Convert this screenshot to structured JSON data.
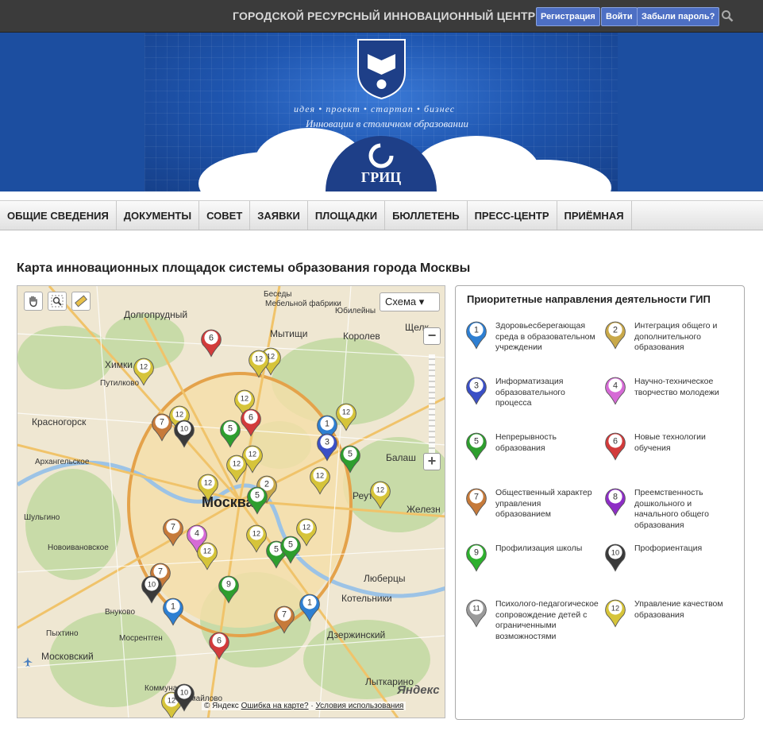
{
  "header": {
    "site_name": "ГОРОДСКОЙ РЕСУРСНЫЙ ИННОВАЦИОННЫЙ ЦЕНТР",
    "register_label": "Регистрация",
    "login_label": "Войти",
    "forgot_label": "Забыли пароль?"
  },
  "banner": {
    "slogan": "идея • проект • стартап • бизнес",
    "subslogan": "Инновации в столичном образовании",
    "logo_text": "ГРИЦ"
  },
  "nav": {
    "items": [
      "ОБЩИЕ СВЕДЕНИЯ",
      "ДОКУМЕНТЫ",
      "СОВЕТ",
      "ЗАЯВКИ",
      "ПЛОЩАДКИ",
      "БЮЛЛЕТЕНЬ",
      "ПРЕСС-ЦЕНТР",
      "ПРИЁМНАЯ"
    ]
  },
  "page_title": "Карта инновационных площадок системы образования города Москвы",
  "map": {
    "type_label": "Схема ▾",
    "zoom_in": "+",
    "zoom_out": "−",
    "copyright": "© Яндекс",
    "report_error": "Ошибка на карте?",
    "terms": "Условия использования",
    "brand": "Яндекс",
    "labels": {
      "dolgoprudny": "Долгопрудный",
      "mytishchi": "Мытищи",
      "korolev": "Королев",
      "khimki": "Химки",
      "putilkovo": "Путилково",
      "krasnogorsk": "Красногорск",
      "arkhangelskoe": "Архангельское",
      "shulgino": "Шульгино",
      "novoivanovskoe": "Новоивановское",
      "vnukovo": "Внуково",
      "moscow": "Москва",
      "balashikha": "Балаш",
      "reutov": "Реут",
      "zheleznodorozhny": "Железн",
      "lyubertsy": "Люберцы",
      "kotelniki": "Котельники",
      "dzerzhinsky": "Дзержинский",
      "lytkarino": "Лыткарино",
      "moskovsky": "Московский",
      "mosrentgen": "Мосрентген",
      "pyktusi": "Пыхтино",
      "shchelkovo": "Щелк",
      "beskudnikovo": "Беседы",
      "mebel": "Мебельной фабрики",
      "yubileyny": "Юбилейны",
      "kommunarka": "Коммунарка",
      "izmaylovo": "Измайлово"
    },
    "pins": [
      {
        "n": "6",
        "color": "#d23b3b"
      },
      {
        "n": "12",
        "color": "#d6c43a"
      },
      {
        "n": "12",
        "color": "#d6c43a"
      },
      {
        "n": "12",
        "color": "#d6c43a"
      },
      {
        "n": "12",
        "color": "#d6c43a"
      },
      {
        "n": "7",
        "color": "#c67a3a"
      },
      {
        "n": "12",
        "color": "#d6c43a"
      },
      {
        "n": "10",
        "color": "#3a3a3a"
      },
      {
        "n": "5",
        "color": "#2e9e2e"
      },
      {
        "n": "6",
        "color": "#d23b3b"
      },
      {
        "n": "1",
        "color": "#2e7fd2"
      },
      {
        "n": "12",
        "color": "#d6c43a"
      },
      {
        "n": "3",
        "color": "#3a4fc6"
      },
      {
        "n": "5",
        "color": "#2e9e2e"
      },
      {
        "n": "12",
        "color": "#d6c43a"
      },
      {
        "n": "12",
        "color": "#d6c43a"
      },
      {
        "n": "12",
        "color": "#d6c43a"
      },
      {
        "n": "12",
        "color": "#d6c43a"
      },
      {
        "n": "2",
        "color": "#c9a94a"
      },
      {
        "n": "5",
        "color": "#2e9e2e"
      },
      {
        "n": "12",
        "color": "#d6c43a"
      },
      {
        "n": "12",
        "color": "#d6c43a"
      },
      {
        "n": "7",
        "color": "#c67a3a"
      },
      {
        "n": "4",
        "color": "#d66ad6"
      },
      {
        "n": "12",
        "color": "#d6c43a"
      },
      {
        "n": "5",
        "color": "#2e9e2e"
      },
      {
        "n": "5",
        "color": "#2e9e2e"
      },
      {
        "n": "12",
        "color": "#d6c43a"
      },
      {
        "n": "7",
        "color": "#c67a3a"
      },
      {
        "n": "10",
        "color": "#3a3a3a"
      },
      {
        "n": "9",
        "color": "#2e9e2e"
      },
      {
        "n": "1",
        "color": "#2e7fd2"
      },
      {
        "n": "1",
        "color": "#2e7fd2"
      },
      {
        "n": "7",
        "color": "#c67a3a"
      },
      {
        "n": "6",
        "color": "#d23b3b"
      },
      {
        "n": "12",
        "color": "#d6c43a"
      },
      {
        "n": "10",
        "color": "#3a3a3a"
      }
    ]
  },
  "legend": {
    "title": "Приоритетные направления деятельности ГИП",
    "items": [
      {
        "n": "1",
        "color": "#2e7fd2",
        "text": "Здоровьесберегающая среда в образовательном учреждении"
      },
      {
        "n": "2",
        "color": "#c9a94a",
        "text": "Интеграция общего и дополнительного образования"
      },
      {
        "n": "3",
        "color": "#3a4fc6",
        "text": "Информатизация образовательного процесса"
      },
      {
        "n": "4",
        "color": "#d66ad6",
        "text": "Научно-техническое творчество молодежи"
      },
      {
        "n": "5",
        "color": "#2e9e2e",
        "text": "Непрерывность образования"
      },
      {
        "n": "6",
        "color": "#d23b3b",
        "text": "Новые технологии обучения"
      },
      {
        "n": "7",
        "color": "#c67a3a",
        "text": "Общественный характер управления образованием"
      },
      {
        "n": "8",
        "color": "#8e2ec6",
        "text": "Преемственность дошкольного и начального общего образования"
      },
      {
        "n": "9",
        "color": "#2eb02e",
        "text": "Профилизация школы"
      },
      {
        "n": "10",
        "color": "#3a3a3a",
        "text": "Профориентация"
      },
      {
        "n": "11",
        "color": "#9a9a9a",
        "text": "Психолого-педагогическое сопровождение детей с ограниченными возможностями"
      },
      {
        "n": "12",
        "color": "#d6c43a",
        "text": "Управление качеством образования"
      }
    ]
  }
}
